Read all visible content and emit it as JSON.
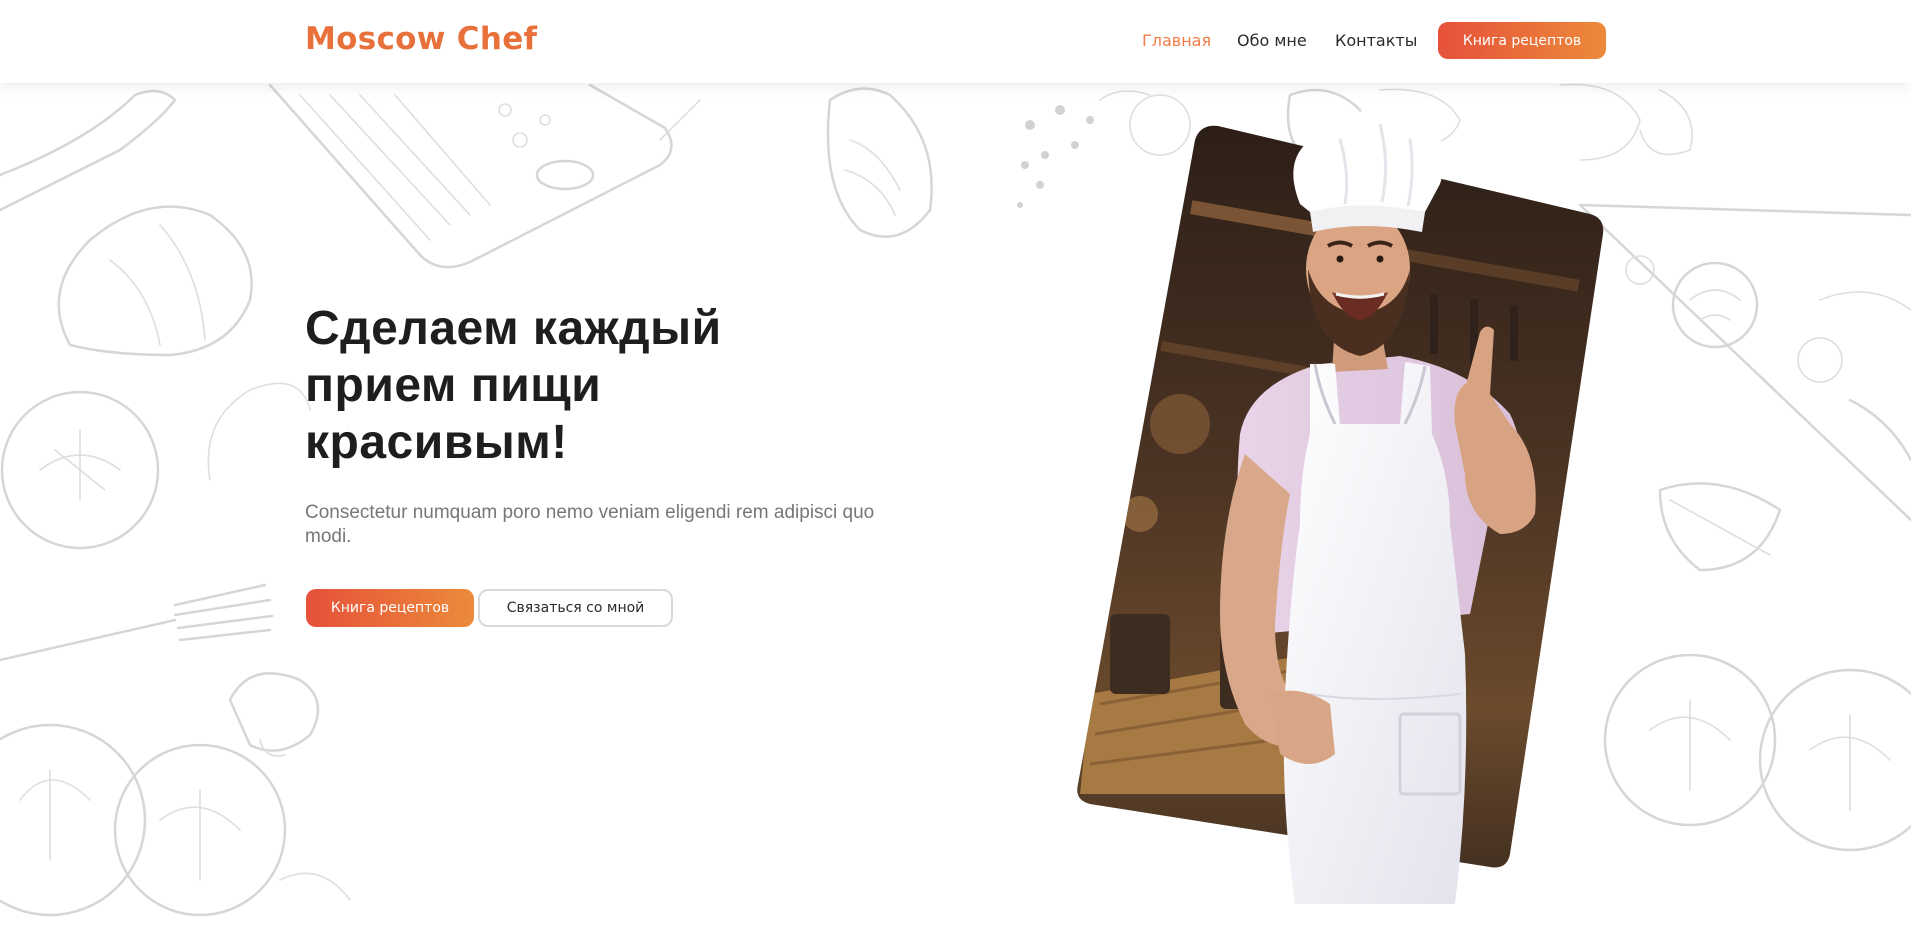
{
  "header": {
    "logo": "Moscow Chef",
    "nav": {
      "home": "Главная",
      "about": "Обо мне",
      "contacts": "Контакты"
    },
    "cta_label": "Книга рецептов"
  },
  "hero": {
    "title": "Сделаем каждый прием пищи красивым!",
    "subtitle": "Consectetur numquam poro nemo veniam eligendi rem adipisci quo modi.",
    "primary_button": "Книга рецептов",
    "secondary_button": "Связаться со мной"
  },
  "colors": {
    "accent": "#ef7b45",
    "gradient_start": "#e6513a",
    "gradient_end": "#ec8a3a",
    "title": "#1e1e1e",
    "subtitle": "#777777"
  },
  "icons": [
    "chef-photo",
    "food-doodle-pattern"
  ]
}
